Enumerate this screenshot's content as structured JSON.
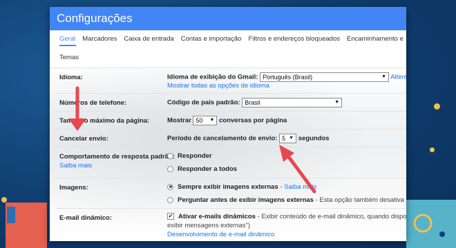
{
  "window": {
    "title": "Configurações"
  },
  "tabs": [
    "Geral",
    "Marcadores",
    "Caixa de entrada",
    "Contas e importação",
    "Filtros e endereços bloqueados",
    "Encaminhamento e"
  ],
  "tabs_row2": "Temas",
  "settings": {
    "idioma": {
      "label": "Idioma:",
      "prefix": "Idioma de exibição do Gmail:",
      "select": "Português (Brasil)",
      "link": "Altere as",
      "link2": "Mostrar todas as opções de idioma"
    },
    "telefone": {
      "label": "Números de telefone:",
      "prefix": "Código de país padrão:",
      "select": "Brasil"
    },
    "tamanho": {
      "label": "Tamanho máximo da página:",
      "prefix": "Mostrar",
      "select": "50",
      "suffix": "conversas por página"
    },
    "cancelar": {
      "label": "Cancelar envio:",
      "prefix": "Período de cancelamento de envio:",
      "select": "5",
      "suffix": "segundos"
    },
    "resposta": {
      "label": "Comportamento de resposta padrão:",
      "link": "Saiba mais",
      "opt1": "Responder",
      "opt2": "Responder a todos"
    },
    "imagens": {
      "label": "Imagens:",
      "opt1": "Sempre exibir imagens externas",
      "opt1_link": "Saiba mais",
      "opt2": "Perguntar antes de exibir imagens externas",
      "opt2_note": "- Esta opção também desativa e-mails"
    },
    "dinamico": {
      "label": "E-mail dinâmico:",
      "opt1": "Ativar e-mails dinâmicos",
      "opt1_note": "- Exibir conteúdo de e-mail dinâmico, quando disponível. (",
      "opt1_note2": "exibir mensagens externas\")",
      "link": "Desenvolvimento de e-mail dinâmico"
    }
  },
  "colors": {
    "header": "#4285f4",
    "accent": "#1a73e8",
    "annotation_arrow": "#e8474f"
  }
}
